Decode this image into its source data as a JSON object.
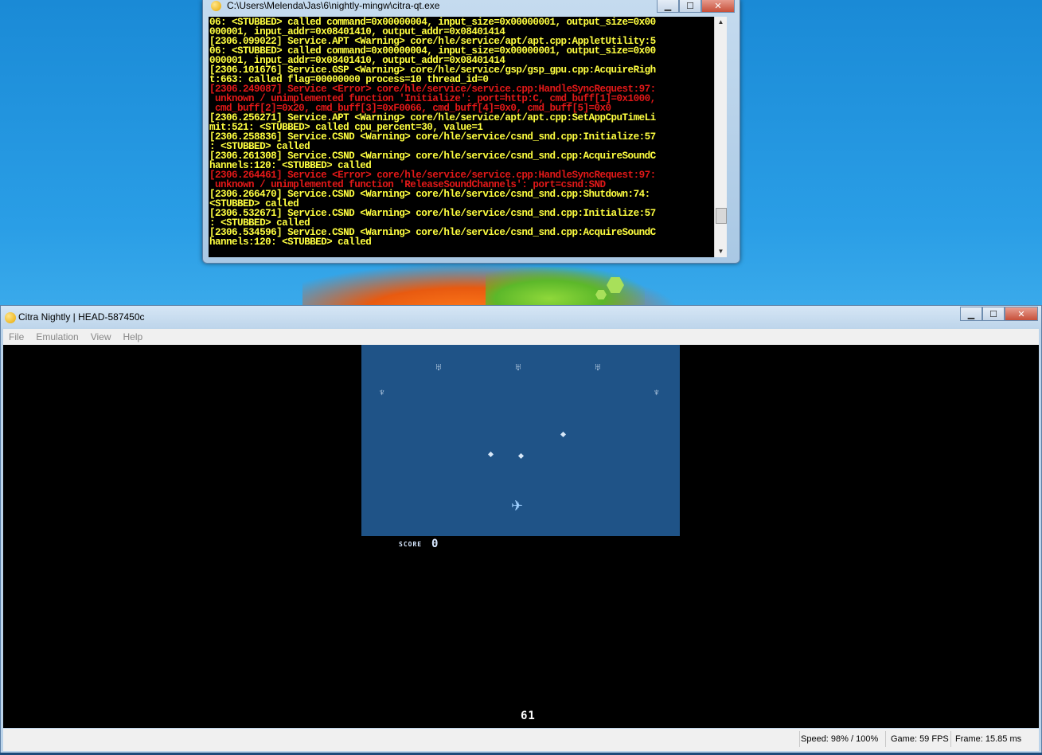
{
  "console": {
    "title": "C:\\Users\\Melenda\\Jas\\6\\nightly-mingw\\citra-qt.exe",
    "lines": [
      {
        "text": "06: <STUBBED> called command=0x00000004, input_size=0x00000001, output_size=0x00",
        "level": "warn"
      },
      {
        "text": "000001, input_addr=0x08401410, output_addr=0x08401414",
        "level": "warn"
      },
      {
        "text": "[2306.099022] Service.APT <Warning> core/hle/service/apt/apt.cpp:AppletUtility:5",
        "level": "warn"
      },
      {
        "text": "06: <STUBBED> called command=0x00000004, input_size=0x00000001, output_size=0x00",
        "level": "warn"
      },
      {
        "text": "000001, input_addr=0x08401410, output_addr=0x08401414",
        "level": "warn"
      },
      {
        "text": "[2306.101676] Service.GSP <Warning> core/hle/service/gsp/gsp_gpu.cpp:AcquireRigh",
        "level": "warn"
      },
      {
        "text": "t:663: called flag=00000000 process=10 thread_id=0",
        "level": "warn"
      },
      {
        "text": "[2306.249087] Service <Error> core/hle/service/service.cpp:HandleSyncRequest:97:",
        "level": "error"
      },
      {
        "text": " unknown / unimplemented function 'Initialize': port=http:C, cmd_buff[1]=0x1000,",
        "level": "error"
      },
      {
        "text": " cmd_buff[2]=0x20, cmd_buff[3]=0xF0066, cmd_buff[4]=0x0, cmd_buff[5]=0x0",
        "level": "error"
      },
      {
        "text": "[2306.256271] Service.APT <Warning> core/hle/service/apt/apt.cpp:SetAppCpuTimeLi",
        "level": "warn"
      },
      {
        "text": "mit:521: <STUBBED> called cpu_percent=30, value=1",
        "level": "warn"
      },
      {
        "text": "[2306.258836] Service.CSND <Warning> core/hle/service/csnd_snd.cpp:Initialize:57",
        "level": "warn"
      },
      {
        "text": ": <STUBBED> called",
        "level": "warn"
      },
      {
        "text": "[2306.261308] Service.CSND <Warning> core/hle/service/csnd_snd.cpp:AcquireSoundC",
        "level": "warn"
      },
      {
        "text": "hannels:120: <STUBBED> called",
        "level": "warn"
      },
      {
        "text": "[2306.264461] Service <Error> core/hle/service/service.cpp:HandleSyncRequest:97:",
        "level": "error"
      },
      {
        "text": " unknown / unimplemented function 'ReleaseSoundChannels': port=csnd:SND",
        "level": "error"
      },
      {
        "text": "[2306.266470] Service.CSND <Warning> core/hle/service/csnd_snd.cpp:Shutdown:74:",
        "level": "warn"
      },
      {
        "text": "<STUBBED> called",
        "level": "warn"
      },
      {
        "text": "[2306.532671] Service.CSND <Warning> core/hle/service/csnd_snd.cpp:Initialize:57",
        "level": "warn"
      },
      {
        "text": ": <STUBBED> called",
        "level": "warn"
      },
      {
        "text": "[2306.534596] Service.CSND <Warning> core/hle/service/csnd_snd.cpp:AcquireSoundC",
        "level": "warn"
      },
      {
        "text": "hannels:120: <STUBBED> called",
        "level": "warn"
      }
    ],
    "colors": {
      "warn": "#ffff40",
      "error": "#e21818",
      "background": "#000000"
    }
  },
  "citra": {
    "title": "Citra Nightly | HEAD-587450c",
    "menu": [
      "File",
      "Emulation",
      "View",
      "Help"
    ],
    "game": {
      "score_label": "SCORE",
      "score_value": "0",
      "counter": "61",
      "enemy_icons": [
        "bug-enemy-icon",
        "bug-enemy-icon",
        "bug-enemy-icon",
        "bird-enemy-icon",
        "bird-enemy-icon"
      ],
      "top_screen_color": "#1f5387"
    },
    "status": {
      "speed": "Speed: 98% / 100%",
      "game_fps": "Game: 59 FPS",
      "frame": "Frame: 15.85 ms"
    }
  },
  "window_controls": {
    "minimize": "▁",
    "maximize": "☐",
    "close": "✕"
  }
}
